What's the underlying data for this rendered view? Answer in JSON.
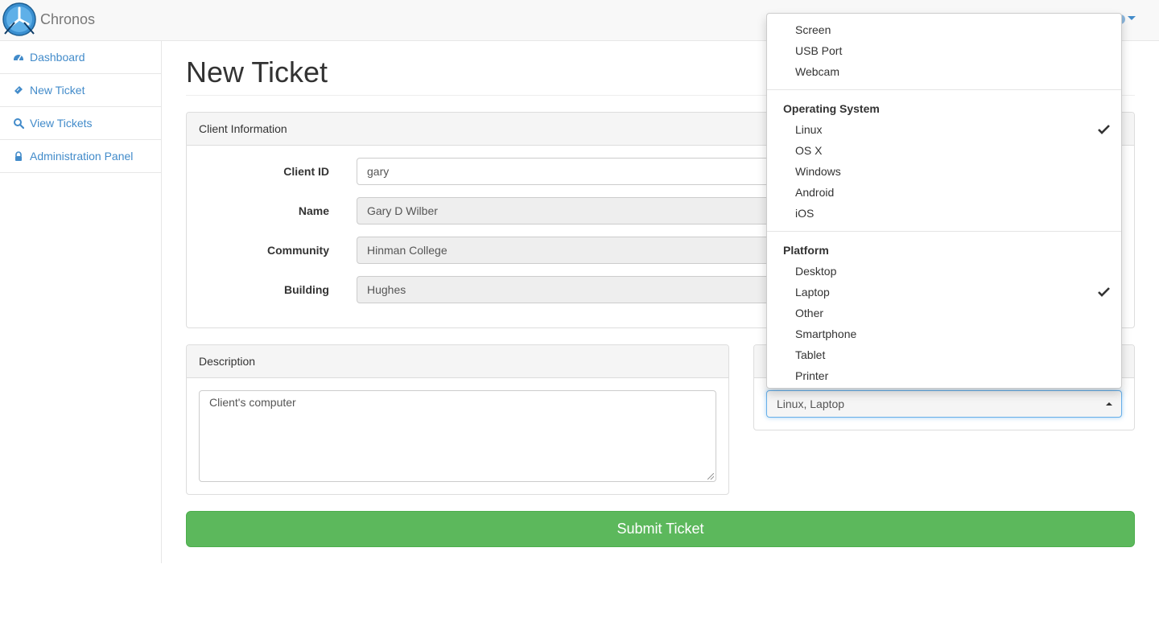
{
  "app": {
    "brand": "Chronos"
  },
  "sidebar": {
    "items": [
      {
        "label": "Dashboard",
        "icon": "dashboard-icon"
      },
      {
        "label": "New Ticket",
        "icon": "ticket-icon"
      },
      {
        "label": "View Tickets",
        "icon": "search-icon"
      },
      {
        "label": "Administration Panel",
        "icon": "lock-icon"
      }
    ]
  },
  "page": {
    "title": "New Ticket"
  },
  "client_panel": {
    "heading": "Client Information",
    "fields": [
      {
        "label": "Client ID",
        "value": "gary",
        "readonly": false
      },
      {
        "label": "Name",
        "value": "Gary D Wilber",
        "readonly": true
      },
      {
        "label": "Community",
        "value": "Hinman College",
        "readonly": true
      },
      {
        "label": "Building",
        "value": "Hughes",
        "readonly": true
      }
    ]
  },
  "description_panel": {
    "heading": "Description",
    "text": "Client's computer"
  },
  "tags_select": {
    "value": "Linux, Laptop"
  },
  "submit": {
    "label": "Submit Ticket"
  },
  "dropdown": {
    "groups": [
      {
        "header": "",
        "items": [
          {
            "label": "Screen",
            "selected": false
          },
          {
            "label": "USB Port",
            "selected": false
          },
          {
            "label": "Webcam",
            "selected": false
          }
        ]
      },
      {
        "header": "Operating System",
        "items": [
          {
            "label": "Linux",
            "selected": true
          },
          {
            "label": "OS X",
            "selected": false
          },
          {
            "label": "Windows",
            "selected": false
          },
          {
            "label": "Android",
            "selected": false
          },
          {
            "label": "iOS",
            "selected": false
          }
        ]
      },
      {
        "header": "Platform",
        "items": [
          {
            "label": "Desktop",
            "selected": false
          },
          {
            "label": "Laptop",
            "selected": true
          },
          {
            "label": "Other",
            "selected": false
          },
          {
            "label": "Smartphone",
            "selected": false
          },
          {
            "label": "Tablet",
            "selected": false
          },
          {
            "label": "Printer",
            "selected": false
          }
        ]
      }
    ]
  },
  "colors": {
    "link": "#428bca",
    "success": "#5cb85c",
    "panel_heading": "#f5f5f5",
    "border": "#dddddd"
  }
}
